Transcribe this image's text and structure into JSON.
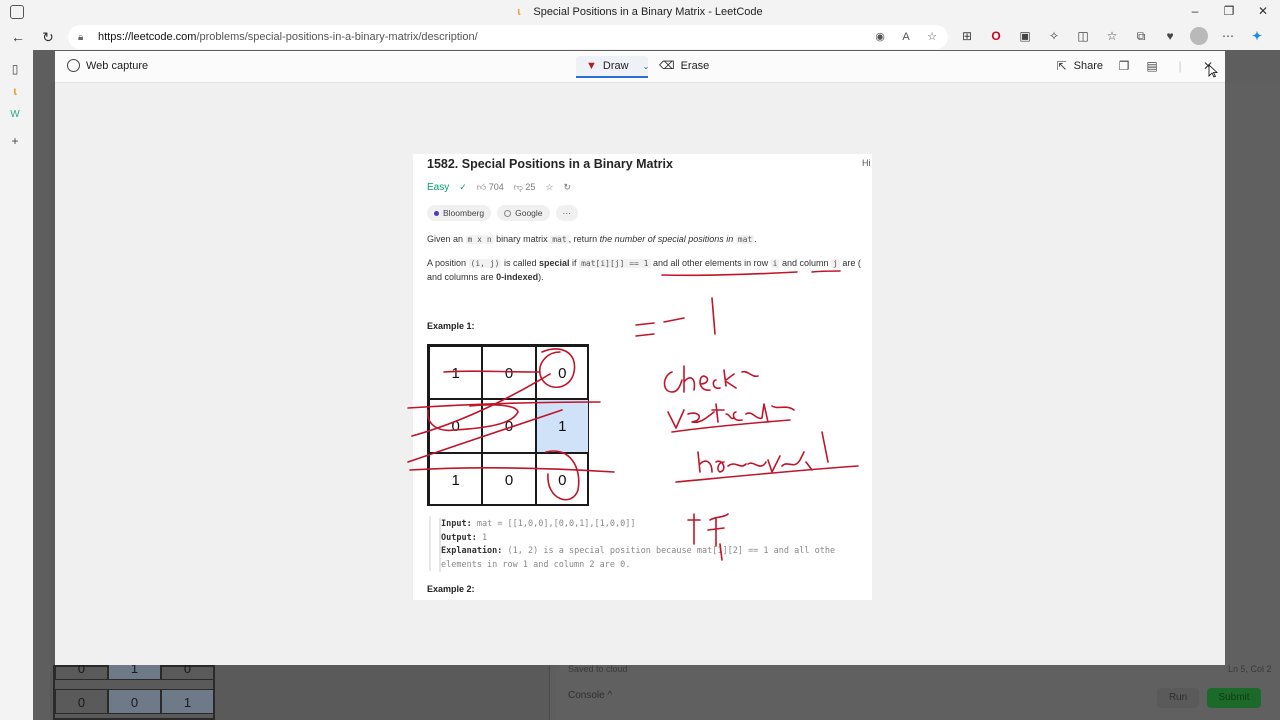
{
  "browser": {
    "window_title": "Special Positions in a Binary Matrix - LeetCode",
    "url_host": "https://leetcode.com",
    "url_path": "/problems/special-positions-in-a-binary-matrix/description/"
  },
  "capture": {
    "title": "Web capture",
    "draw_label": "Draw",
    "erase_label": "Erase",
    "share_label": "Share"
  },
  "problem": {
    "title": "1582. Special Positions in a Binary Matrix",
    "hint": "Hi",
    "difficulty": "Easy",
    "likes": "704",
    "dislikes": "25",
    "tags": [
      "Bloomberg",
      "Google"
    ],
    "more": "···",
    "desc1_a": "Given an",
    "desc1_code1": "m x n",
    "desc1_b": "binary matrix",
    "desc1_code2": "mat",
    "desc1_c": ", return",
    "desc1_em": "the number of special positions in",
    "desc1_code3": "mat",
    "desc1_end": ".",
    "desc2_a": "A position",
    "desc2_code1": "(i, j)",
    "desc2_b": "is called",
    "desc2_strong": "special",
    "desc2_c": "if",
    "desc2_code2": "mat[i][j] == 1",
    "desc2_d": "and all other elements in row",
    "desc2_code3": "i",
    "desc2_e": "and column",
    "desc2_code4": "j",
    "desc2_f": "are",
    "desc2_g": "(",
    "desc3_a": "and columns are",
    "desc3_strong": "0-indexed",
    "desc3_end": ").",
    "example1": "Example 1:",
    "example2": "Example 2:",
    "matrix": [
      [
        "1",
        "0",
        "0"
      ],
      [
        "0",
        "0",
        "1"
      ],
      [
        "1",
        "0",
        "0"
      ]
    ],
    "input_label": "Input:",
    "input_value": "mat = [[1,0,0],[0,0,1],[1,0,0]]",
    "output_label": "Output:",
    "output_value": "1",
    "explanation_label": "Explanation:",
    "explanation_line1": "(1, 2) is a special position because mat[1][2] == 1 and all othe",
    "explanation_line2": "elements in row 1 and column 2 are 0."
  },
  "background": {
    "saved": "Saved to cloud",
    "console": "Console ^",
    "run": "Run",
    "submit": "Submit",
    "status": "Ln 5, Col 2",
    "matrix_row": [
      "0",
      "1",
      "0"
    ],
    "matrix_row2": [
      "0",
      "0",
      "1"
    ]
  },
  "colors": {
    "ink": "#c0152a",
    "easy": "#00a36c",
    "highlight": "#cfe2f8",
    "draw_accent": "#2a6ed1"
  }
}
